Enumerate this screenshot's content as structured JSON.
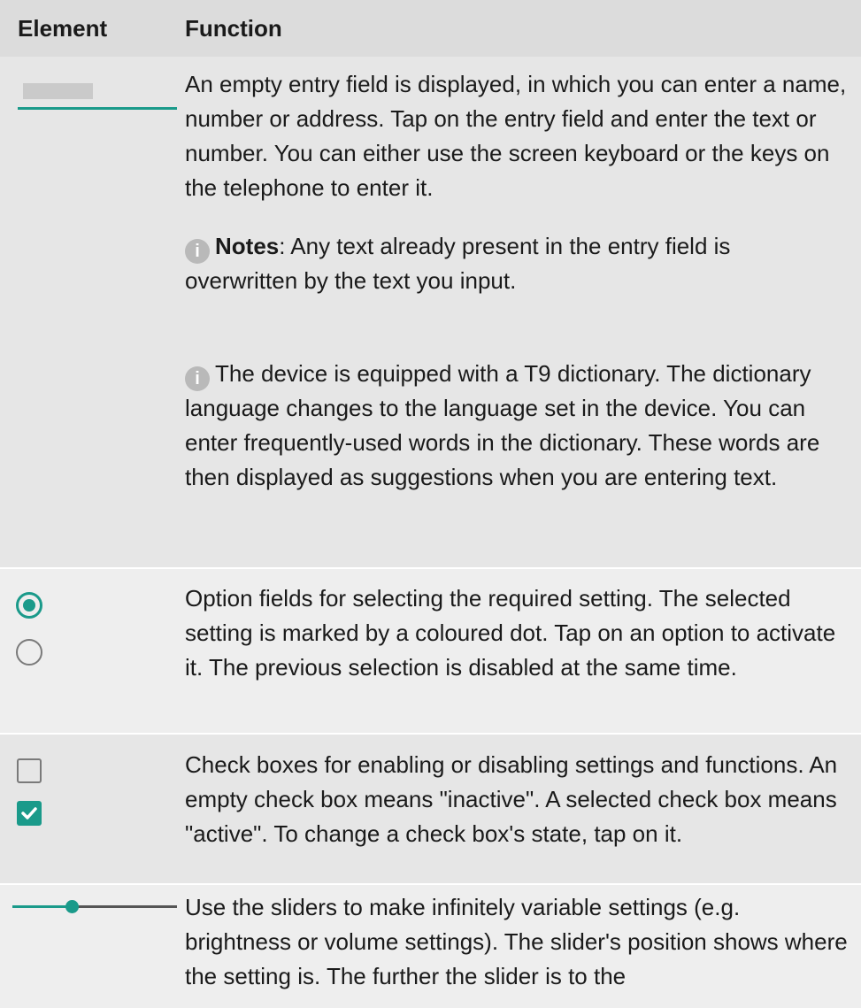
{
  "header": {
    "element": "Element",
    "function": "Function"
  },
  "rows": {
    "entry": {
      "text": "An empty entry field is displayed, in which you can enter a name, number or address. Tap on the entry field and enter the text or number. You can either use the screen keyboard or the keys on the telephone to enter it.",
      "note1_label": "Notes",
      "note1_text": ": Any text already present in the entry field is overwritten by the text you input.",
      "note2_text": "The device is equipped with a T9 dictionary. The dictionary language changes to the language set in the device. You can enter frequently-used words in the dictionary. These words are then displayed as suggestions when you are entering text.",
      "info_icon": "i"
    },
    "option": {
      "text": "Option fields for selecting the required setting. The selected setting is marked by a coloured dot. Tap on an option to activate it. The previous selection is disabled at the same time."
    },
    "check": {
      "text": "Check boxes for enabling or disabling settings and functions. An empty check box means \"inactive\". A selected check box means \"active\". To change a check box's state, tap on it."
    },
    "slider": {
      "text": "Use the sliders to make infinitely variable settings (e.g. brightness or volume settings). The slider's position shows where the setting is. The further the slider is to the",
      "value_fraction": 0.34
    }
  },
  "colors": {
    "accent": "#1a9a8a",
    "header_bg": "#dcdcdc",
    "row_bg_a": "#e6e6e6",
    "row_bg_b": "#eeeeee"
  }
}
